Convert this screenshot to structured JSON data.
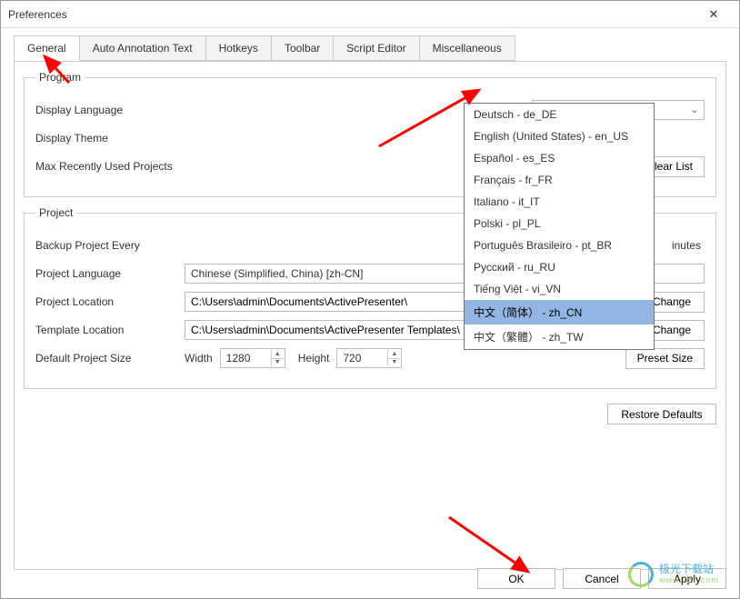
{
  "window": {
    "title": "Preferences"
  },
  "tabs": {
    "items": [
      "General",
      "Auto Annotation Text",
      "Hotkeys",
      "Toolbar",
      "Script Editor",
      "Miscellaneous"
    ],
    "active": 0
  },
  "program": {
    "legend": "Program",
    "display_language_label": "Display Language",
    "display_language_value": "中文（简体） - zh_CN",
    "display_theme_label": "Display Theme",
    "max_recent_label": "Max Recently Used Projects",
    "clear_list_btn": "Clear List"
  },
  "language_options": [
    "Deutsch - de_DE",
    "English (United States) - en_US",
    "Español - es_ES",
    "Français - fr_FR",
    "Italiano - it_IT",
    "Polski - pl_PL",
    "Português Brasileiro - pt_BR",
    "Русский - ru_RU",
    "Tiếng Việt - vi_VN",
    "中文（简体） - zh_CN",
    "中文（繁體） - zh_TW"
  ],
  "language_selected_index": 9,
  "project": {
    "legend": "Project",
    "backup_label": "Backup Project Every",
    "backup_unit_suffix": "inutes",
    "project_language_label": "Project Language",
    "project_language_value": "Chinese (Simplified, China) [zh-CN]",
    "project_location_label": "Project Location",
    "project_location_value": "C:\\Users\\admin\\Documents\\ActivePresenter\\",
    "template_location_label": "Template Location",
    "template_location_value": "C:\\Users\\admin\\Documents\\ActivePresenter Templates\\",
    "change_btn": "Change",
    "default_size_label": "Default Project Size",
    "width_label": "Width",
    "width_value": "1280",
    "height_label": "Height",
    "height_value": "720",
    "preset_btn": "Preset Size"
  },
  "restore_btn": "Restore Defaults",
  "footer": {
    "ok": "OK",
    "cancel": "Cancel",
    "apply": "Apply"
  },
  "watermark": {
    "name": "极光下载站",
    "url": "www.xz7.com"
  }
}
